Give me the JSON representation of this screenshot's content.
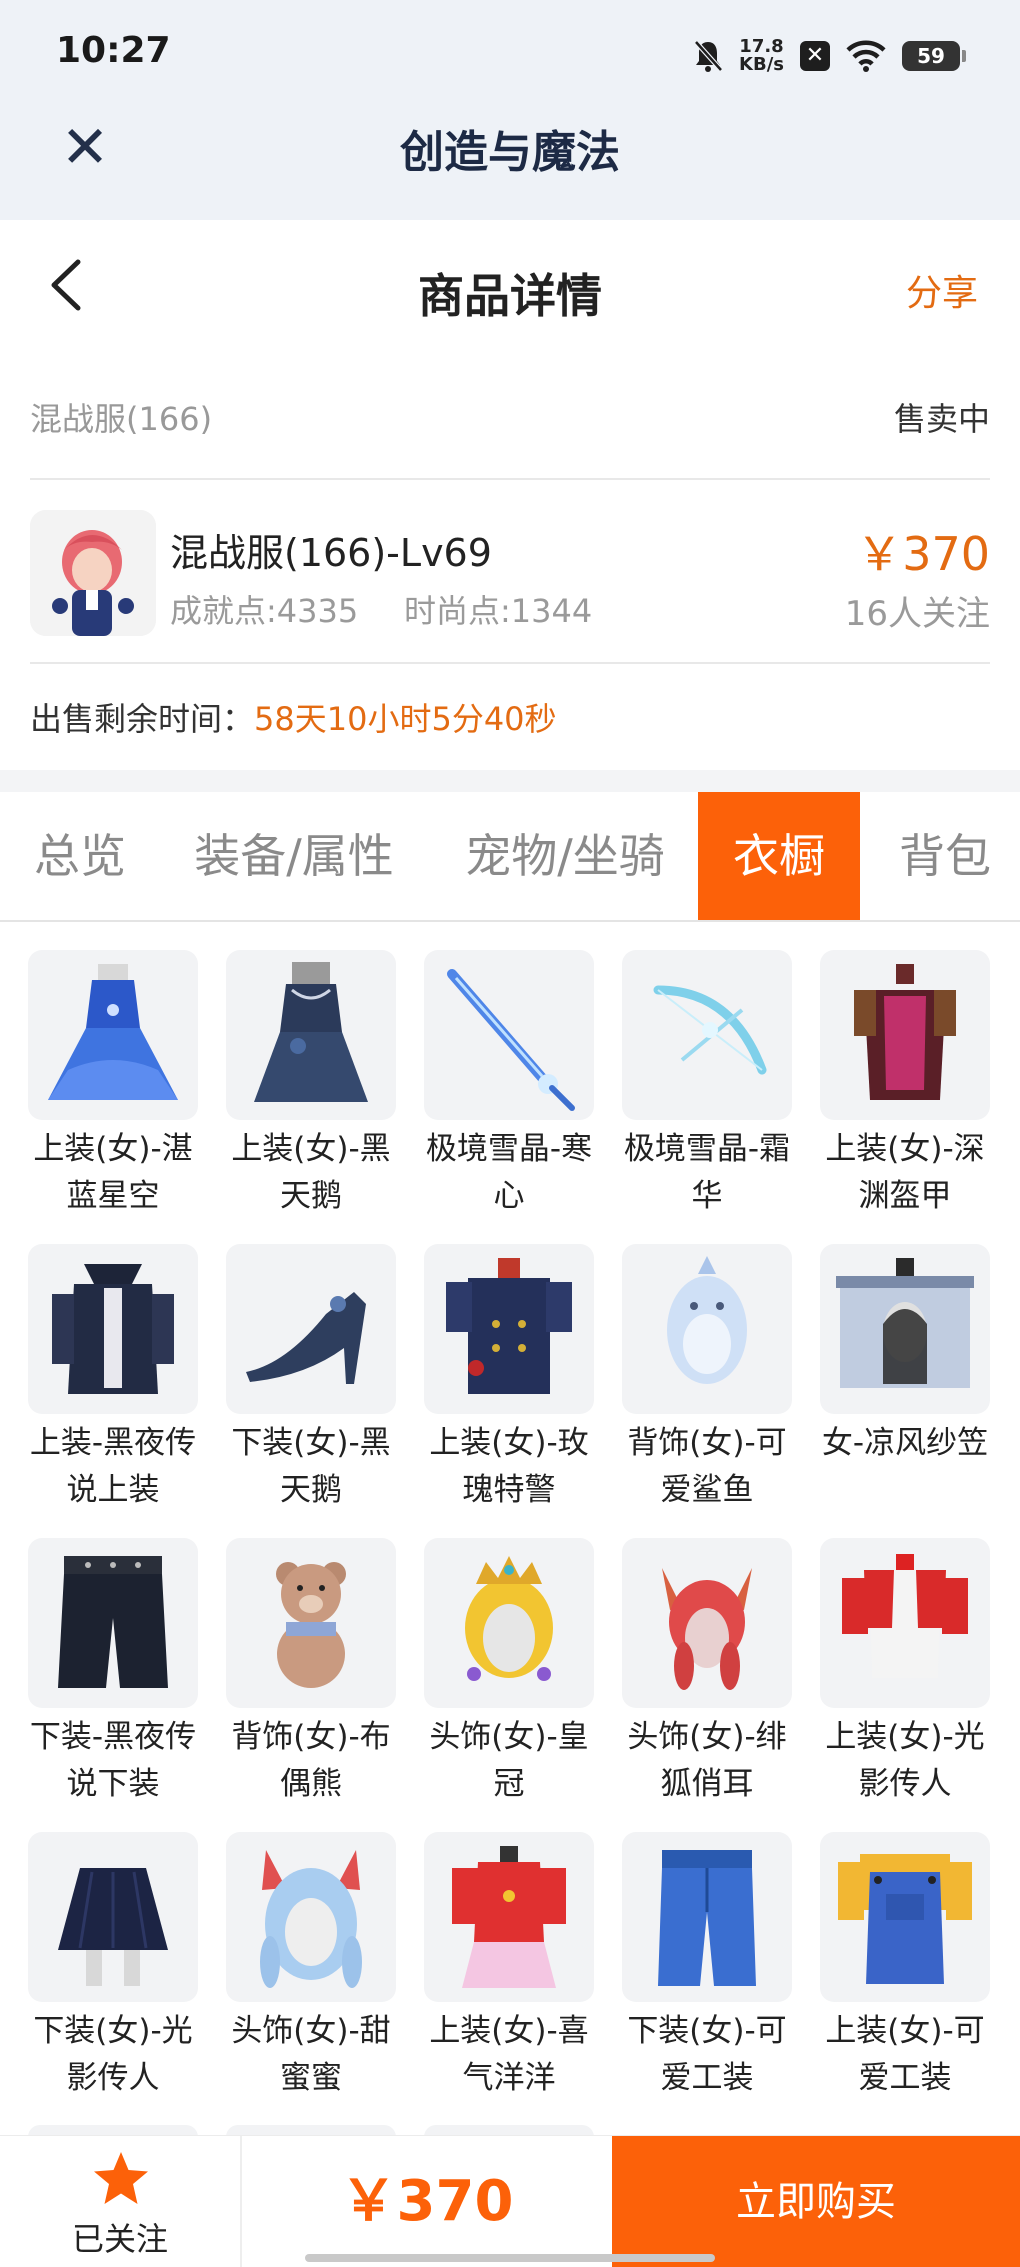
{
  "status_bar": {
    "time": "10:27",
    "net_speed_value": "17.8",
    "net_speed_unit": "KB/s",
    "battery": "59",
    "icons": [
      "bell-muted-icon",
      "x-app-icon",
      "wifi-icon",
      "battery-icon"
    ]
  },
  "app_header": {
    "title": "创造与魔法",
    "close_icon": "close-icon"
  },
  "page_header": {
    "title": "商品详情",
    "share_label": "分享",
    "back_icon": "chevron-left-icon"
  },
  "listing": {
    "server": "混战服(166)",
    "status": "售卖中",
    "character_name": "混战服(166)-Lv69",
    "achievement": "成就点:4335",
    "fashion": "时尚点:1344",
    "price": "￥370",
    "followers": "16人关注",
    "remaining_label": "出售剩余时间：",
    "remaining_value": "58天10小时5分40秒"
  },
  "tabs": [
    {
      "label": "总览",
      "active": false
    },
    {
      "label": "装备/属性",
      "active": false
    },
    {
      "label": "宠物/坐骑",
      "active": false
    },
    {
      "label": "衣橱",
      "active": true
    },
    {
      "label": "背包",
      "active": false
    }
  ],
  "wardrobe": [
    {
      "name": "上装(女)-湛蓝星空",
      "icon": "blue-dress-icon"
    },
    {
      "name": "上装(女)-黑天鹅",
      "icon": "dark-dress-icon"
    },
    {
      "name": "极境雪晶-寒心",
      "icon": "ice-sword-icon"
    },
    {
      "name": "极境雪晶-霜华",
      "icon": "ice-bow-icon"
    },
    {
      "name": "上装(女)-深渊盔甲",
      "icon": "abyss-armor-icon"
    },
    {
      "name": "上装-黑夜传说上装",
      "icon": "night-coat-icon"
    },
    {
      "name": "下装(女)-黑天鹅",
      "icon": "high-heel-icon"
    },
    {
      "name": "上装(女)-玫瑰特警",
      "icon": "police-jacket-icon"
    },
    {
      "name": "背饰(女)-可爱鲨鱼",
      "icon": "shark-backpack-icon"
    },
    {
      "name": "女-凉风纱笠",
      "icon": "veil-hat-icon"
    },
    {
      "name": "下装-黑夜传说下装",
      "icon": "dark-pants-icon"
    },
    {
      "name": "背饰(女)-布偶熊",
      "icon": "teddy-bear-icon"
    },
    {
      "name": "头饰(女)-皇冠",
      "icon": "crown-icon"
    },
    {
      "name": "头饰(女)-绯狐俏耳",
      "icon": "fox-ears-icon"
    },
    {
      "name": "上装(女)-光影传人",
      "icon": "red-jacket-icon"
    },
    {
      "name": "下装(女)-光影传人",
      "icon": "pleated-skirt-icon"
    },
    {
      "name": "头饰(女)-甜蜜蜜",
      "icon": "cat-ears-icon"
    },
    {
      "name": "上装(女)-喜气洋洋",
      "icon": "qipao-icon"
    },
    {
      "name": "下装(女)-可爱工装",
      "icon": "jeans-icon"
    },
    {
      "name": "上装(女)-可爱工装",
      "icon": "overalls-icon"
    }
  ],
  "bottom_bar": {
    "follow_label": "已关注",
    "price": "￥370",
    "buy_label": "立即购买"
  },
  "colors": {
    "accent": "#fc6109",
    "price": "#e36b12",
    "header_bg": "#eef2f7",
    "muted": "#9a9a9a"
  }
}
